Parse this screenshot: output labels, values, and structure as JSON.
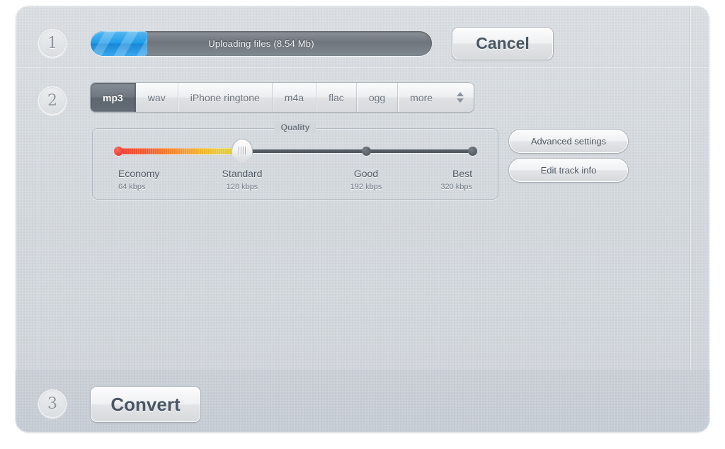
{
  "steps": [
    {
      "number": "1"
    },
    {
      "number": "2"
    },
    {
      "number": "3"
    }
  ],
  "upload": {
    "status_text": "Uploading files (8.54 Mb)",
    "progress_percent": 16.6,
    "cancel_label": "Cancel"
  },
  "formats": {
    "tabs": [
      {
        "label": "mp3",
        "active": true
      },
      {
        "label": "wav",
        "active": false
      },
      {
        "label": "iPhone ringtone",
        "active": false
      },
      {
        "label": "m4a",
        "active": false
      },
      {
        "label": "flac",
        "active": false
      },
      {
        "label": "ogg",
        "active": false
      },
      {
        "label": "more",
        "active": false
      }
    ]
  },
  "quality": {
    "legend": "Quality",
    "selected_index": 1,
    "handle_percent": 35,
    "levels": [
      {
        "name": "Economy",
        "rate": "64 kbps",
        "position_percent": 0
      },
      {
        "name": "Standard",
        "rate": "128 kbps",
        "position_percent": 35
      },
      {
        "name": "Good",
        "rate": "192 kbps",
        "position_percent": 70
      },
      {
        "name": "Best",
        "rate": "320 kbps",
        "position_percent": 100
      }
    ]
  },
  "side_buttons": {
    "advanced_label": "Advanced settings",
    "edit_label": "Edit track info"
  },
  "convert": {
    "label": "Convert"
  },
  "colors": {
    "window_bg": "#d3d8dd",
    "footer_bg": "#c8ced5",
    "progress_fill": "#1f9ce8",
    "active_tab": "#6d757f",
    "quality_low": "#ef3a32",
    "quality_high": "#d3d43a",
    "text_dark": "#4a5663"
  }
}
